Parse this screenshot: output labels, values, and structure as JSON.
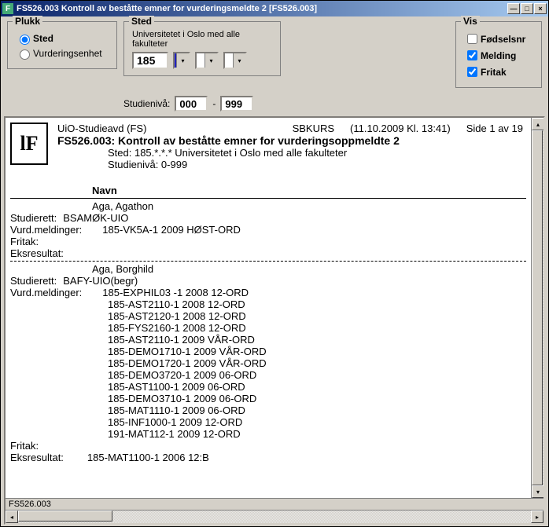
{
  "window": {
    "title": "FS526.003 Kontroll av beståtte emner for vurderingsmeldte 2  [FS526.003]"
  },
  "plukk": {
    "legend": "Plukk",
    "sted_label": "Sted",
    "vurd_label": "Vurderingsenhet"
  },
  "sted": {
    "legend": "Sted",
    "subtitle": "Universitetet i Oslo med alle fakulteter",
    "value": "185"
  },
  "studieniva": {
    "label": "Studienivå:",
    "from": "000",
    "to": "999",
    "sep": "-"
  },
  "vis": {
    "legend": "Vis",
    "fodselsnr": "Fødselsnr",
    "melding": "Melding",
    "fritak": "Fritak"
  },
  "report": {
    "header_left": "UiO-Studieavd (FS)",
    "header_mid": "SBKURS",
    "header_date": "(11.10.2009 Kl. 13:41)",
    "header_page": "Side 1 av 19",
    "title": "FS526.003: Kontroll av beståtte emner for vurderingsoppmeldte 2",
    "sub1": "Sted: 185.*.*.* Universitetet i Oslo med alle fakulteter",
    "sub2": "Studienivå: 0-999",
    "navn_header": "Navn",
    "labels": {
      "studierett": "Studierett:",
      "vurdmeld": "Vurd.meldinger:",
      "fritak": "Fritak:",
      "eksresultat": "Eksresultat:"
    },
    "students": [
      {
        "name": "Aga, Agathon",
        "studierett": "BSAMØK-UIO",
        "vurdmeld": [
          "185-VK5A-1 2009 HØST-ORD"
        ],
        "fritak": "",
        "eksresultat": ""
      },
      {
        "name": "Aga, Borghild",
        "studierett": "BAFY-UIO(begr)",
        "vurdmeld": [
          "185-EXPHIL03 -1 2008 12-ORD",
          "185-AST2110-1 2008 12-ORD",
          "185-AST2120-1 2008 12-ORD",
          "185-FYS2160-1 2008 12-ORD",
          "185-AST2110-1 2009 VÅR-ORD",
          "185-DEMO1710-1 2009 VÅR-ORD",
          "185-DEMO1720-1 2009 VÅR-ORD",
          "185-DEMO3720-1 2009 06-ORD",
          "185-AST1100-1 2009 06-ORD",
          "185-DEMO3710-1 2009 06-ORD",
          "185-MAT1110-1 2009 06-ORD",
          "185-INF1000-1 2009 12-ORD",
          "191-MAT112-1 2009 12-ORD"
        ],
        "fritak": "",
        "eksresultat": "185-MAT1100-1 2006 12:B"
      }
    ]
  },
  "status": "FS526.003"
}
